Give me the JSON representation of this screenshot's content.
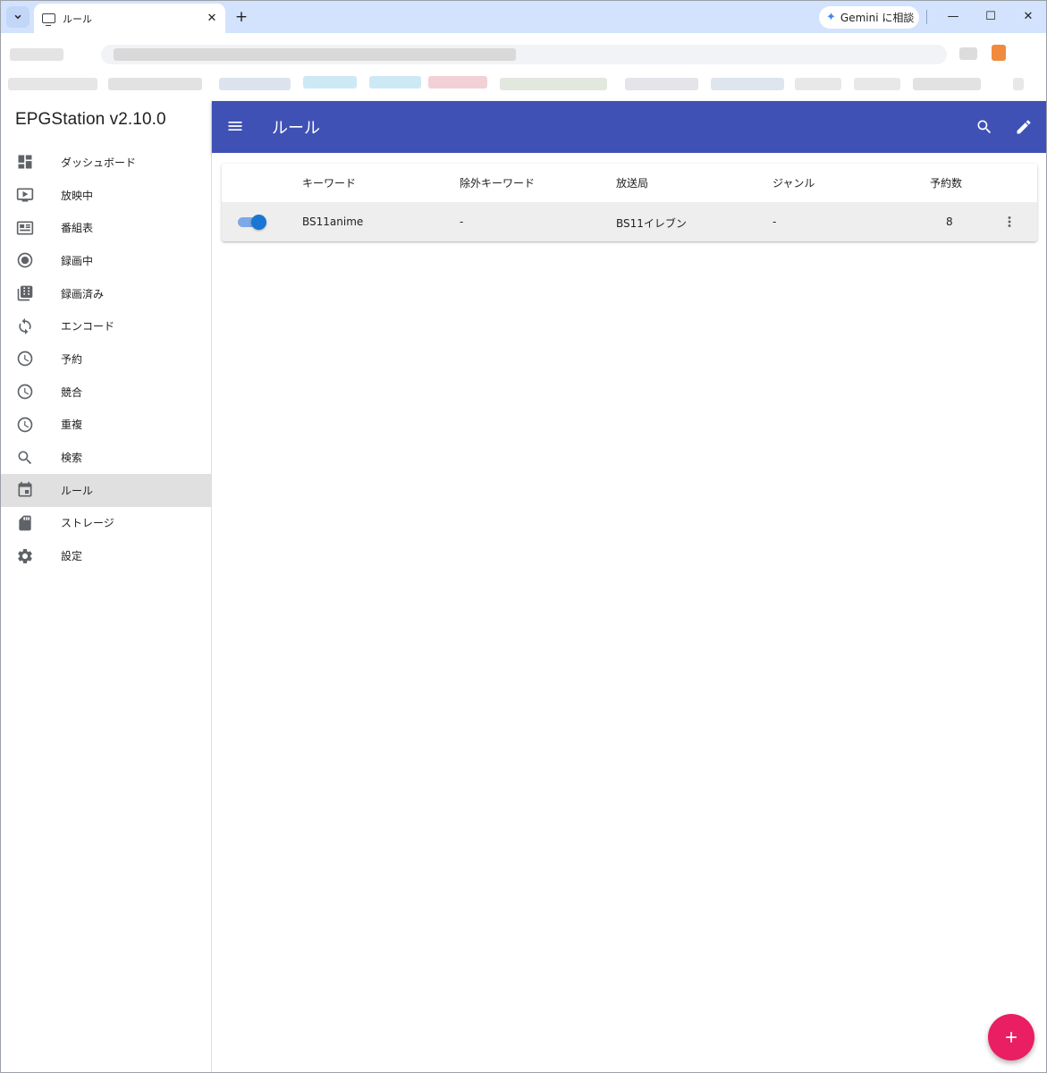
{
  "browser": {
    "tab_title": "ルール",
    "tab_close": "✕",
    "new_tab": "+",
    "gemini_label": "Gemini に相談",
    "window_controls": {
      "minimize": "—",
      "maximize": "☐",
      "close": "✕"
    }
  },
  "app": {
    "title": "EPGStation v2.10.0",
    "page_title": "ルール",
    "accent_color": "#3f51b5",
    "fab_color": "#e91e63"
  },
  "sidebar": {
    "items": [
      {
        "label": "ダッシュボード",
        "icon": "dashboard-icon"
      },
      {
        "label": "放映中",
        "icon": "tv-play-icon"
      },
      {
        "label": "番組表",
        "icon": "guide-icon"
      },
      {
        "label": "録画中",
        "icon": "record-icon"
      },
      {
        "label": "録画済み",
        "icon": "video-library-icon"
      },
      {
        "label": "エンコード",
        "icon": "sync-icon"
      },
      {
        "label": "予約",
        "icon": "clock-icon"
      },
      {
        "label": "競合",
        "icon": "clock-icon"
      },
      {
        "label": "重複",
        "icon": "clock-icon"
      },
      {
        "label": "検索",
        "icon": "search-icon"
      },
      {
        "label": "ルール",
        "icon": "calendar-icon",
        "active": true
      },
      {
        "label": "ストレージ",
        "icon": "sd-card-icon"
      },
      {
        "label": "設定",
        "icon": "gear-icon"
      }
    ]
  },
  "table": {
    "headers": {
      "keyword": "キーワード",
      "ignore_keyword": "除外キーワード",
      "channel": "放送局",
      "genre": "ジャンル",
      "reserves": "予約数"
    },
    "rows": [
      {
        "enabled": true,
        "keyword": "BS11anime",
        "ignore_keyword": "-",
        "channel": "BS11イレブン",
        "genre": "-",
        "reserves": "8"
      }
    ]
  }
}
